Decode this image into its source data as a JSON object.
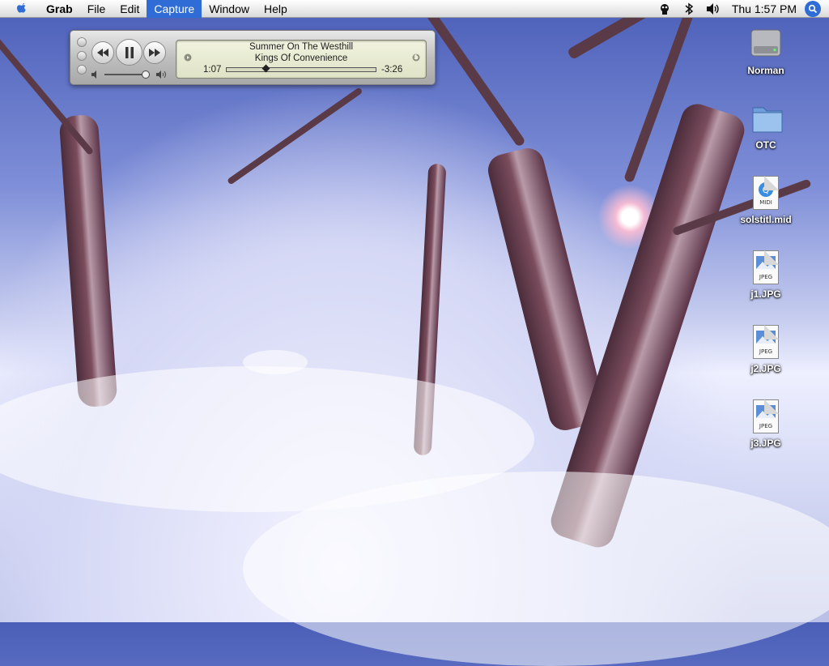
{
  "menubar": {
    "apple_icon": "apple-logo-icon",
    "items": [
      {
        "label": "Grab"
      },
      {
        "label": "File"
      },
      {
        "label": "Edit"
      },
      {
        "label": "Capture"
      },
      {
        "label": "Window"
      },
      {
        "label": "Help"
      }
    ],
    "active_item": "Capture",
    "status_icons": [
      "script-menu-icon",
      "bluetooth-icon",
      "volume-icon"
    ],
    "clock": "Thu 1:57 PM",
    "spotlight_icon": "spotlight-icon"
  },
  "player": {
    "song": "Summer On The Westhill",
    "artist": "Kings Of Convenience",
    "elapsed": "1:07",
    "remaining": "-3:26",
    "progress_fraction": 0.25,
    "volume_fraction": 0.9,
    "controls": [
      "rewind-icon",
      "pause-icon",
      "fast-forward-icon"
    ]
  },
  "desktop_icons": [
    {
      "label": "Norman",
      "icon": "hard-drive-icon"
    },
    {
      "label": "OTC",
      "icon": "folder-icon"
    },
    {
      "label": "solstitl.mid",
      "icon": "midi-file-icon",
      "tag": "MIDI"
    },
    {
      "label": "j1.JPG",
      "icon": "jpeg-file-icon",
      "tag": "JPEG"
    },
    {
      "label": "j2.JPG",
      "icon": "jpeg-file-icon",
      "tag": "JPEG"
    },
    {
      "label": "j3.JPG",
      "icon": "jpeg-file-icon",
      "tag": "JPEG"
    }
  ],
  "colors": {
    "menu_highlight": "#2f6cd6",
    "lcd_background": "#e8ebd2",
    "sky": "#4b5fb8",
    "snow": "#e9ecff"
  }
}
